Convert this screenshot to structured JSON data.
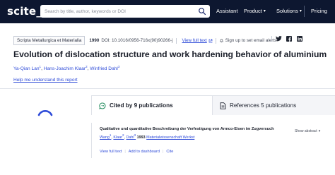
{
  "nav": {
    "logo": "scite",
    "logo_suffix": "_",
    "search_placeholder": "Search by title, author, keywords or DOI",
    "items": [
      {
        "label": "Assistant"
      },
      {
        "label": "Product"
      },
      {
        "label": "Solutions"
      },
      {
        "label": "Pricing"
      }
    ]
  },
  "paper": {
    "journal": "Scripta Metallurgica et Materialia",
    "year": "1990",
    "doi": "DOI: 10.1016/0956-716x(90)90266-j",
    "fulltext_label": "View full text",
    "alert_label": "Sign up to set email alerts",
    "title": "Evolution of dislocation structure and work hardening behavior of aluminium",
    "authors": [
      {
        "name": "Ya-Qian Lan",
        "sup": "1"
      },
      {
        "name": "Hans-Joachim Klaar",
        "sup": "2"
      },
      {
        "name": "Winfried Dahl",
        "sup": "3"
      }
    ],
    "help_link": "Help me understand this report"
  },
  "tabs": {
    "cited_by": "Cited by 9 publications",
    "references": "References 5 publications"
  },
  "citation": {
    "title": "Qualitative und quantitative Beschreibung der Verfestigung von Armco-Eisen im Zugversuch",
    "authors": [
      "Wang",
      "Klaar",
      "Dahl"
    ],
    "sups": [
      "1",
      "2",
      "3"
    ],
    "year": "1993",
    "journal": "Materialwissenschaft Werkst",
    "show_abstract": "Show abstract",
    "links": {
      "view": "View full text",
      "add": "Add to dashboard",
      "cite": "Cite"
    }
  },
  "colors": {
    "navbar": "#0d1730",
    "link": "#2e4bd8",
    "spinner": "#2e4bd8",
    "tab_icon": "#1e8a5b"
  }
}
